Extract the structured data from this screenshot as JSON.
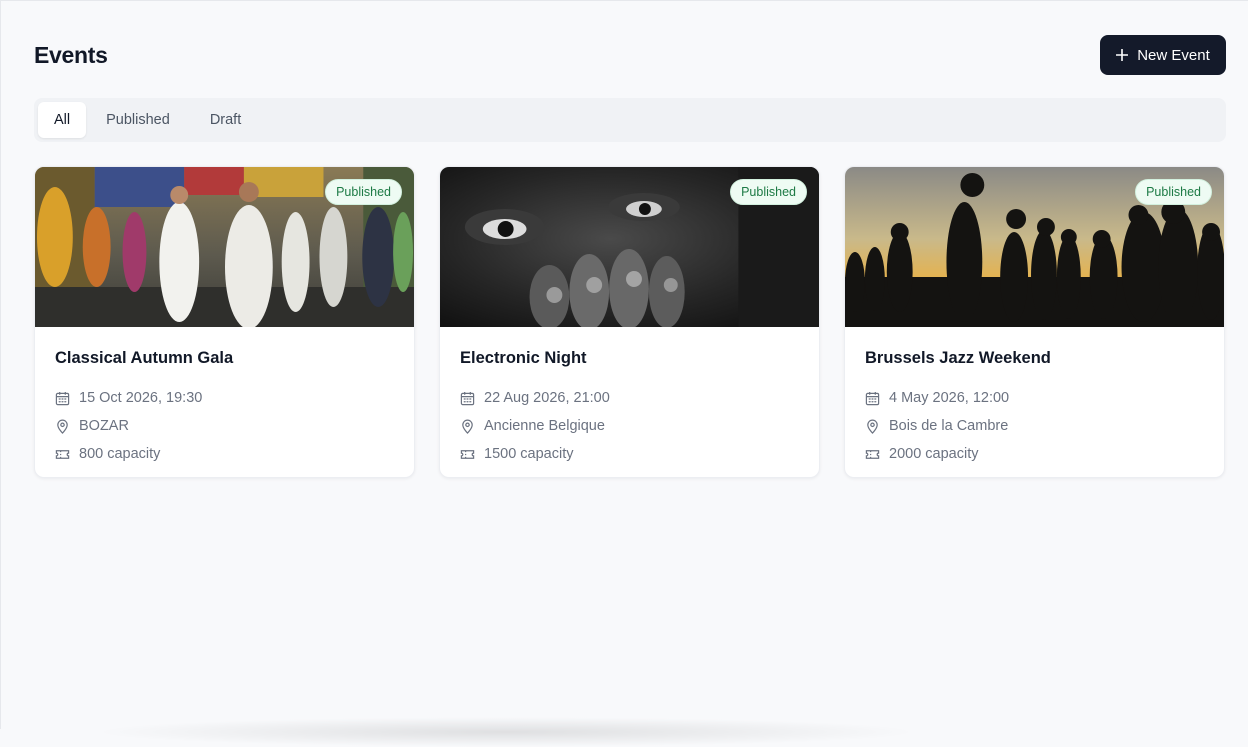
{
  "header": {
    "title": "Events",
    "new_event_label": "New Event"
  },
  "tabs": [
    {
      "label": "All",
      "active": true
    },
    {
      "label": "Published",
      "active": false
    },
    {
      "label": "Draft",
      "active": false
    }
  ],
  "events": [
    {
      "title": "Classical Autumn Gala",
      "status": "Published",
      "datetime": "15 Oct 2026, 19:30",
      "venue": "BOZAR",
      "capacity": "800 capacity",
      "image": "street-festival-photo"
    },
    {
      "title": "Electronic Night",
      "status": "Published",
      "datetime": "22 Aug 2026, 21:00",
      "venue": "Ancienne Belgique",
      "capacity": "1500 capacity",
      "image": "face-closeup-bw-photo"
    },
    {
      "title": "Brussels Jazz Weekend",
      "status": "Published",
      "datetime": "4 May 2026, 12:00",
      "venue": "Bois de la Cambre",
      "capacity": "2000 capacity",
      "image": "sunset-silhouettes-photo"
    }
  ],
  "colors": {
    "primary_button": "#141a2a",
    "badge_bg": "#eefbf3",
    "badge_text": "#1d7a45",
    "muted_text": "#6b7280"
  },
  "icons": {
    "date": "calendar-icon",
    "venue": "map-pin-icon",
    "capacity": "ticket-icon",
    "add": "plus-icon"
  }
}
